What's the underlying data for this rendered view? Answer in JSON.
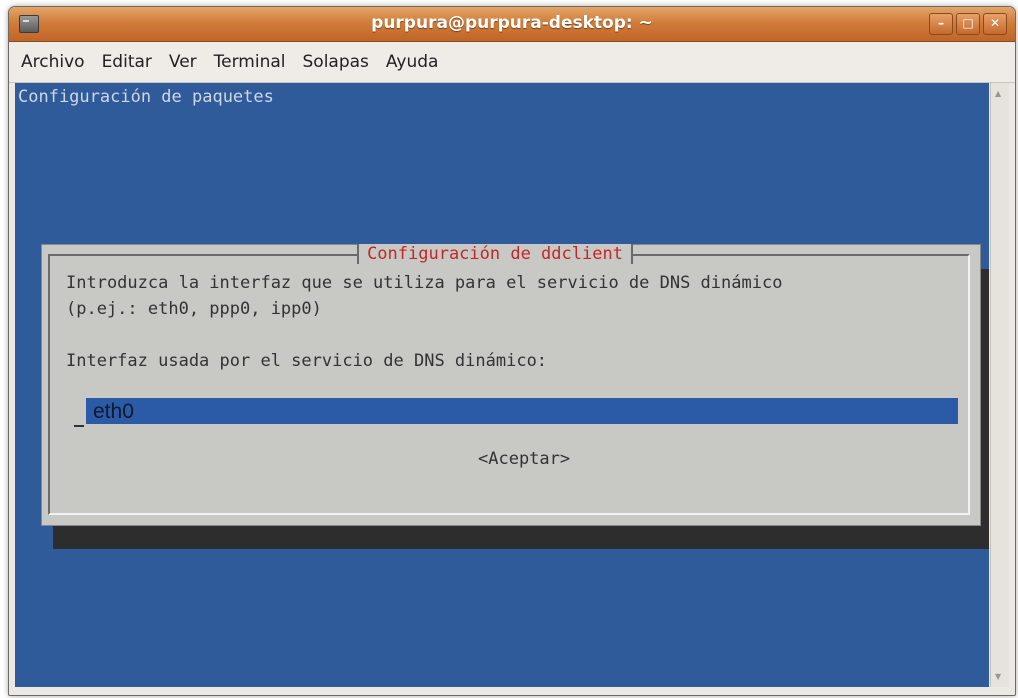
{
  "window": {
    "title": "purpura@purpura-desktop: ~",
    "buttons": {
      "minimize": "–",
      "maximize": "□",
      "close": "✕"
    }
  },
  "menubar": {
    "items": [
      "Archivo",
      "Editar",
      "Ver",
      "Terminal",
      "Solapas",
      "Ayuda"
    ]
  },
  "terminal": {
    "header": "Configuración de paquetes",
    "dialog": {
      "title": "Configuración de ddclient",
      "line1": "Introduzca la interfaz que se utiliza para el servicio de DNS dinámico",
      "line2": "(p.ej.: eth0, ppp0, ipp0)",
      "prompt": "Interfaz usada por el servicio de DNS dinámico:",
      "input_value": "eth0",
      "ok_label": "<Aceptar>"
    }
  },
  "colors": {
    "terminal_background": "#2f5b9b",
    "dialog_background": "#c8c8c4",
    "dialog_title": "#c22828",
    "input_background": "#2b5aa6",
    "titlebar": "#d27d3a"
  }
}
